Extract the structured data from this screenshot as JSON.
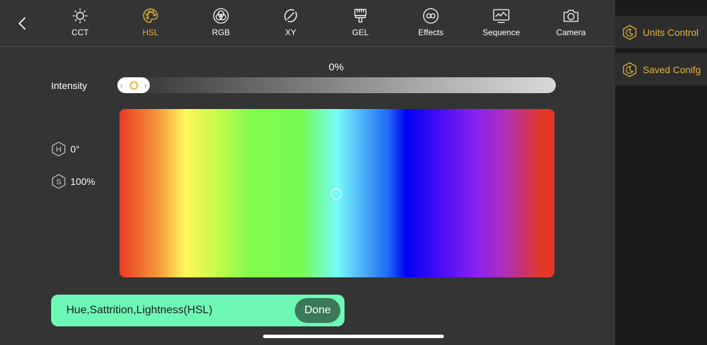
{
  "tabs": [
    {
      "label": "CCT",
      "icon": "sun-icon"
    },
    {
      "label": "HSL",
      "icon": "palette-icon",
      "active": true
    },
    {
      "label": "RGB",
      "icon": "rgb-circles-icon"
    },
    {
      "label": "XY",
      "icon": "xy-icon"
    },
    {
      "label": "GEL",
      "icon": "gel-brush-icon"
    },
    {
      "label": "Effects",
      "icon": "effects-icon"
    },
    {
      "label": "Sequence",
      "icon": "sequence-monitor-icon"
    },
    {
      "label": "Camera",
      "icon": "camera-icon"
    }
  ],
  "intensity": {
    "label": "Intensity",
    "value_text": "0%",
    "value": 0
  },
  "hsl": {
    "hue_letter": "H",
    "hue_value": "0°",
    "sat_letter": "S",
    "sat_value": "100%"
  },
  "info_bar": {
    "text": "Hue,Sattrition,Lightness(HSL)",
    "done_label": "Done"
  },
  "sidebar": {
    "items": [
      {
        "label": "Units Control",
        "icon": "moon-hexagon-icon"
      },
      {
        "label": "Saved Conifg",
        "icon": "moon-hexagon-icon"
      }
    ]
  },
  "colors": {
    "accent": "#e9b23a",
    "info_bar_bg": "#6ef8b6",
    "done_bg": "#3a7a5a",
    "background": "#343434",
    "sidebar_bg": "#1b1b1b"
  }
}
